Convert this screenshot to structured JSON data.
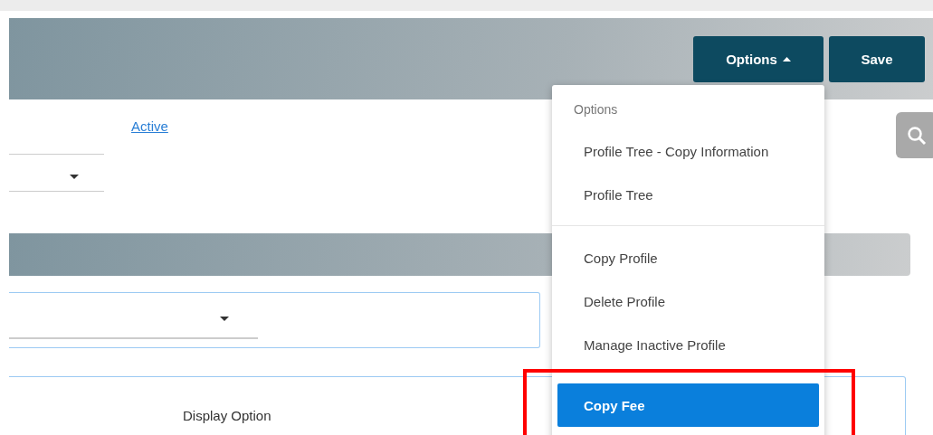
{
  "header": {
    "buttons": [
      {
        "label": "Options",
        "kind": "menu",
        "expanded": true
      },
      {
        "label": "Save",
        "kind": "plain"
      }
    ]
  },
  "status_link": "Active",
  "menu": {
    "heading": "Options",
    "groups": [
      [
        {
          "label": "Profile Tree - Copy Information",
          "selected": false
        },
        {
          "label": "Profile Tree",
          "selected": false
        }
      ],
      [
        {
          "label": "Copy Profile",
          "selected": false
        },
        {
          "label": "Delete Profile",
          "selected": false
        },
        {
          "label": "Manage Inactive Profile",
          "selected": false
        },
        {
          "label": "Copy Fee",
          "selected": true
        }
      ]
    ]
  },
  "display_option": "Display Option",
  "highlight": true
}
